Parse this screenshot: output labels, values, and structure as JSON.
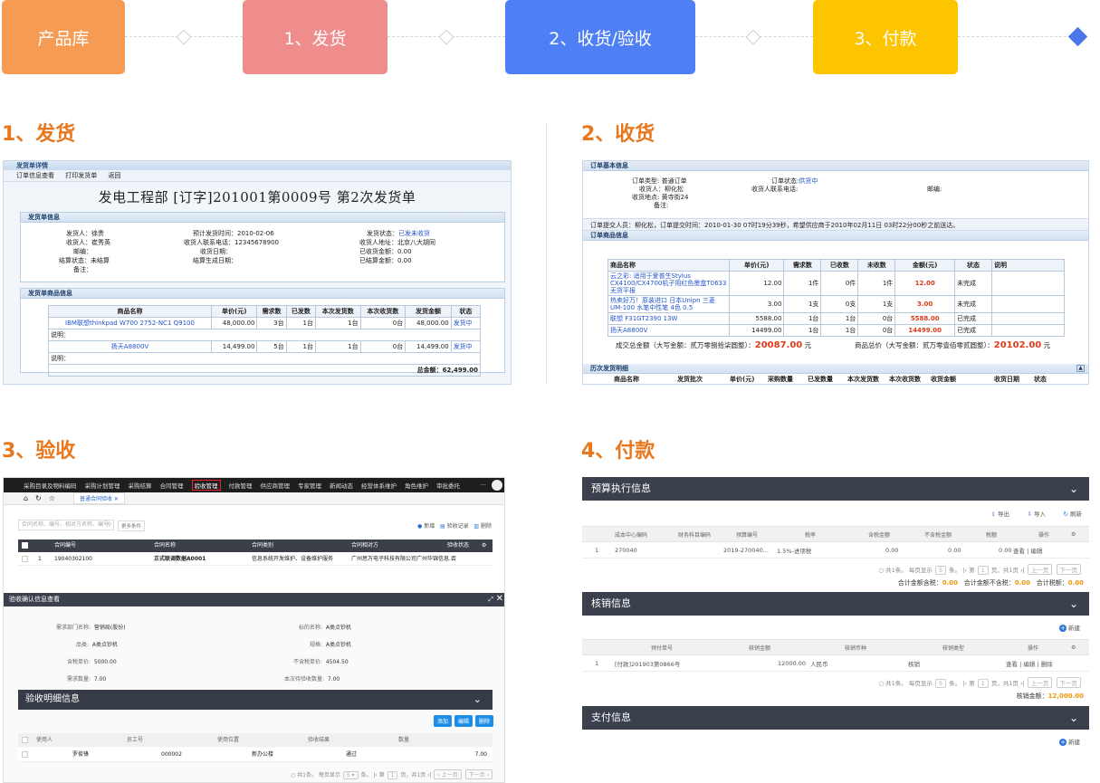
{
  "steps": [
    {
      "label": "产品库",
      "color": "#f69b54"
    },
    {
      "label": "1、发货",
      "color": "#ef8c8c"
    },
    {
      "label": "2、收货/验收",
      "color": "#4f7ff5"
    },
    {
      "label": "3、付款",
      "color": "#fdc400"
    }
  ],
  "sections": {
    "s1": "1、发货",
    "s2": "2、收货",
    "s3": "3、验收",
    "s4": "4、付款"
  },
  "p1": {
    "header": "发货单详情",
    "toolbar": [
      "订单信息查看",
      "打印发货单",
      "返回"
    ],
    "title": "发电工程部  [订字]201001第0009号  第2次发货单",
    "info_header": "发货单信息",
    "info": {
      "shipper_k": "发货人：",
      "shipper_v": "徐贵",
      "receiver_k": "收货人：",
      "receiver_v": "崔秀英",
      "zip_k": "邮编：",
      "settle_k": "结算状态：",
      "settle_v": "未结算",
      "remark_k": "备注：",
      "eta_k": "预计发货时间：",
      "eta_v": "2010-02-06",
      "phone_k": "收货人联系电话：",
      "phone_v": "12345678900",
      "recv_date_k": "收货日期：",
      "settle_date_k": "结算生成日期：",
      "status_k": "发货状态：",
      "status_v": "已发未收货",
      "addr_k": "收货人地址：",
      "addr_v": "北京八大胡同",
      "recv_amount_k": "已收货金额：",
      "recv_amount_v": "0.00",
      "settled_k": "已结算金额：",
      "settled_v": "0.00"
    },
    "goods_header": "发货单商品信息",
    "cols": [
      "商品名称",
      "单价(元)",
      "需求数",
      "已发数",
      "本次发货数",
      "本次收货数",
      "发货金额",
      "状态"
    ],
    "rows": [
      {
        "name": "IBM联想thinkpad W700 2752-NC1 Q9100",
        "price": "48,000.00",
        "need": "3台",
        "sent": "1台",
        "this_send": "1台",
        "this_recv": "0台",
        "amount": "48,000.00",
        "status": "发货中"
      },
      {
        "name": "扬天A8800V",
        "price": "14,499.00",
        "need": "5台",
        "sent": "1台",
        "this_send": "1台",
        "this_recv": "0台",
        "amount": "14,499.00",
        "status": "发货中"
      }
    ],
    "remark_label": "说明：",
    "total": "总金额：62,499.00"
  },
  "p2": {
    "basic_header": "订单基本信息",
    "order_type": "订单类型: 普通订单",
    "receiver": "收货人：柳化松",
    "place": "收货地点: 黄寺街24",
    "remark": "备注:",
    "order_status_k": "订单状态:",
    "order_status_v": "供货中",
    "recv_phone": "收货人联系电话:",
    "zip": "邮编:",
    "notice": "订单提交人员：柳化松，订单提交时间：2010-01-30 07时19分39秒，希望供应商于2010年02月11日 03时22分00秒之前送达。",
    "goods_header": "订单商品信息",
    "cols": [
      "商品名称",
      "单价(元)",
      "需求数",
      "已收数",
      "未收数",
      "金额(元)",
      "状态",
      "说明"
    ],
    "rows": [
      {
        "name": "云之彩: 适用于爱普生Stylus CX4100/CX4700机子用红色墨盒T0633 无货平报",
        "price": "12.00",
        "need": "1件",
        "got": "0件",
        "left": "1件",
        "amount": "12.00",
        "status": "未完成"
      },
      {
        "name": "热卖好万！原装进口 日本Unipn 三菱 UM-100 水笔中性笔 4色 0.5",
        "price": "3.00",
        "need": "1支",
        "got": "0支",
        "left": "1支",
        "amount": "3.00",
        "status": "未完成"
      },
      {
        "name": "联想 F31GT2390 13W",
        "price": "5588.00",
        "need": "1台",
        "got": "1台",
        "left": "0台",
        "amount": "5588.00",
        "status": "已完成"
      },
      {
        "name": "扬天A8800V",
        "price": "14499.00",
        "need": "1台",
        "got": "1台",
        "left": "0台",
        "amount": "14499.00",
        "status": "已完成"
      }
    ],
    "deal_total_label": "成交总金额（大写金额：贰万零捌拾柒圆整）：",
    "deal_total": "20087.00",
    "goods_total_label": "商品总价（大写金额：贰万零壹佰零贰圆整）：",
    "goods_total": "20102.00",
    "yuan": "元",
    "history_header": "历次发货明细",
    "history_cols": [
      "商品名称",
      "发货批次",
      "单价(元)",
      "采购数量",
      "已发数量",
      "本次发货数",
      "本次收货数",
      "收货金额",
      "收货日期",
      "状态"
    ]
  },
  "p3": {
    "nav": [
      "采购目录及物料编码",
      "采购计划管理",
      "采购结算",
      "合同管理",
      "验收管理",
      "付款管理",
      "供应商管理",
      "专家管理",
      "新闻动态",
      "经营体系维护",
      "角色维护",
      "审批委托"
    ],
    "active_nav": "验收管理",
    "tab": "普通合同验收",
    "search_placeholder": "合同名称、编号、相对方名称、编号",
    "more": "更多条件",
    "new": "新增",
    "record": "验收记录",
    "del": "删除",
    "list_cols": [
      "合同编号",
      "合同名称",
      "合同类别",
      "合同相对方",
      "验收状态"
    ],
    "list_row": {
      "idx": "1",
      "no": "19040302100",
      "name": "正式联调数据A0001",
      "type": "信息系统开发维护、设备维护服务",
      "party": "广州思万电子科技有限公司广州华锦信息...",
      "status": "否"
    },
    "dialog_title": "验收确认信息查看",
    "fields": {
      "dept_k": "需求部门名称:",
      "dept_v": "营销局(股份)",
      "item_k": "品类:",
      "item_v": "A类点钞机",
      "price_k": "含税单价:",
      "price_v": "5000.00",
      "qty_k": "需求数量:",
      "qty_v": "7.00",
      "target_k": "标的名称:",
      "target_v": "A类点钞机",
      "spec_k": "规格:",
      "spec_v": "A类点钞机",
      "nprice_k": "不含税单价:",
      "nprice_v": "4504.50",
      "accept_k": "本次待验收数量:",
      "accept_v": "7.00"
    },
    "detail_header": "验收明细信息",
    "btn_add": "添加",
    "btn_edit": "编辑",
    "btn_delete": "删除",
    "detail_cols": [
      "使用人",
      "员工号",
      "使用位置",
      "验收结果",
      "数量"
    ],
    "detail_row": {
      "user": "罗俊锋",
      "emp": "000002",
      "loc": "新办公楼",
      "result": "通过",
      "qty": "7.00"
    },
    "pager": "共1条。 每页显示",
    "pager_page": "页，共1页"
  },
  "p4": {
    "budget_header": "预算执行信息",
    "export": "导出",
    "import": "导入",
    "refresh": "刷新",
    "budget_cols": [
      "成本中心编码",
      "财务科目编码",
      "预算编号",
      "税率",
      "含税金额",
      "不含税金额",
      "税额",
      "操作"
    ],
    "budget_row": {
      "idx": "1",
      "cc": "270040",
      "fin": "",
      "bno": "2019-270040...",
      "tax": "1.5%-进项税",
      "incl": "0.00",
      "excl": "0.00",
      "taxamt": "0.00",
      "op": "查看 | 编辑"
    },
    "pager": "共1条。 每页显示",
    "pager_size": "5",
    "pager_page": "页，共1页",
    "prev": "上一页",
    "next": "下一页",
    "sum_incl_k": "合计金额含税：",
    "sum_incl_v": "0.00",
    "sum_excl_k": "合计金额不含税：",
    "sum_excl_v": "0.00",
    "sum_tax_k": "合计税额：",
    "sum_tax_v": "0.00",
    "writeoff_header": "核销信息",
    "new": "新建",
    "wo_cols": [
      "预付单号",
      "核销金额",
      "核销币种",
      "核销类型",
      "操作"
    ],
    "wo_row": {
      "idx": "1",
      "no": "[付款]201903第0866号",
      "amount": "12000.00",
      "cur": "人民币",
      "type": "核销",
      "op": "查看 | 编辑 | 删除"
    },
    "wo_total_k": "核销金额：",
    "wo_total_v": "12,000.00",
    "pay_header": "支付信息"
  }
}
